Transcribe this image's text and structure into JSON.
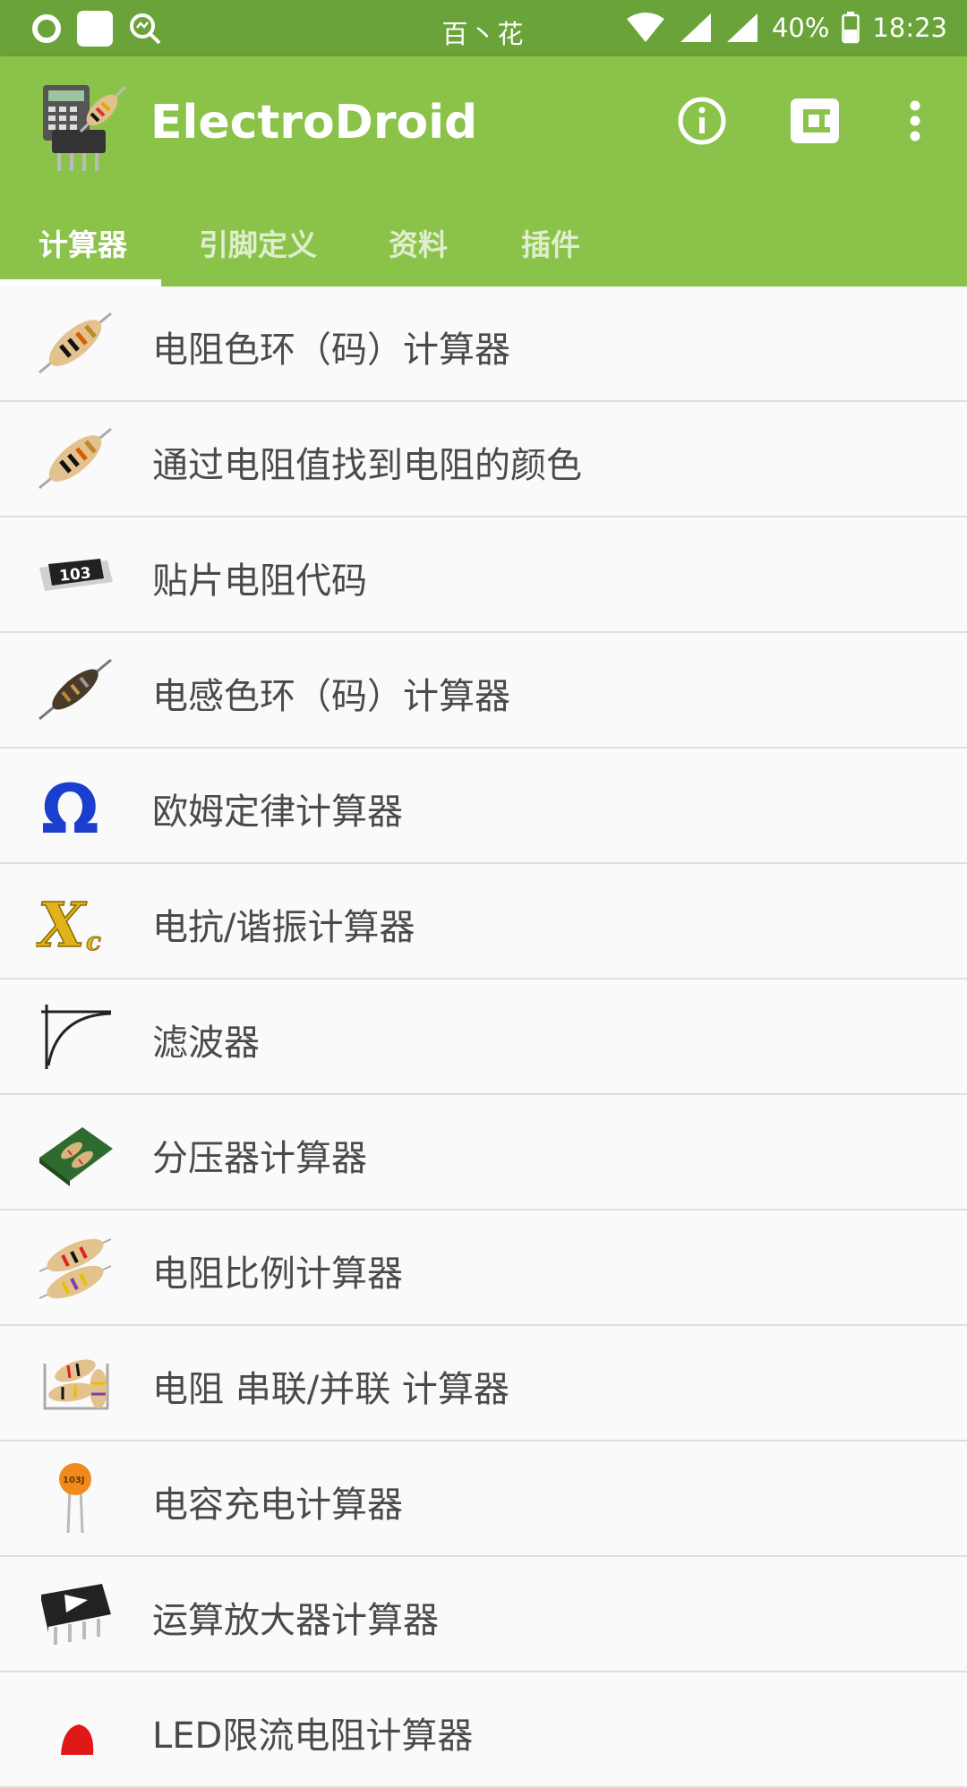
{
  "status_bar": {
    "carrier": "百丶花",
    "battery": "40%",
    "time": "18:23"
  },
  "app_bar": {
    "title": "ElectroDroid",
    "actions": [
      "info-icon",
      "plugin-icon",
      "more-vert-icon"
    ]
  },
  "tabs": [
    {
      "label": "计算器",
      "active": true
    },
    {
      "label": "引脚定义",
      "active": false
    },
    {
      "label": "资料",
      "active": false
    },
    {
      "label": "插件",
      "active": false
    }
  ],
  "calculators": [
    {
      "label": "电阻色环（码）计算器",
      "icon": "resistor-icon"
    },
    {
      "label": "通过电阻值找到电阻的颜色",
      "icon": "resistor-icon"
    },
    {
      "label": "贴片电阻代码",
      "icon": "smd-resistor-icon",
      "icon_text": "103"
    },
    {
      "label": "电感色环（码）计算器",
      "icon": "inductor-icon"
    },
    {
      "label": "欧姆定律计算器",
      "icon": "omega-icon"
    },
    {
      "label": "电抗/谐振计算器",
      "icon": "reactance-icon"
    },
    {
      "label": "滤波器",
      "icon": "filter-curve-icon"
    },
    {
      "label": "分压器计算器",
      "icon": "voltage-divider-icon"
    },
    {
      "label": "电阻比例计算器",
      "icon": "resistor-ratio-icon"
    },
    {
      "label": "电阻 串联/并联 计算器",
      "icon": "series-parallel-icon"
    },
    {
      "label": "电容充电计算器",
      "icon": "capacitor-icon",
      "icon_text": "103J"
    },
    {
      "label": "运算放大器计算器",
      "icon": "op-amp-icon"
    },
    {
      "label": "LED限流电阻计算器",
      "icon": "led-icon"
    }
  ],
  "colors": {
    "status_bar": "#6aa339",
    "app_bar": "#8bc34a",
    "list_bg": "#fafafa",
    "divider": "#dedede",
    "text": "#4a4a4a"
  }
}
